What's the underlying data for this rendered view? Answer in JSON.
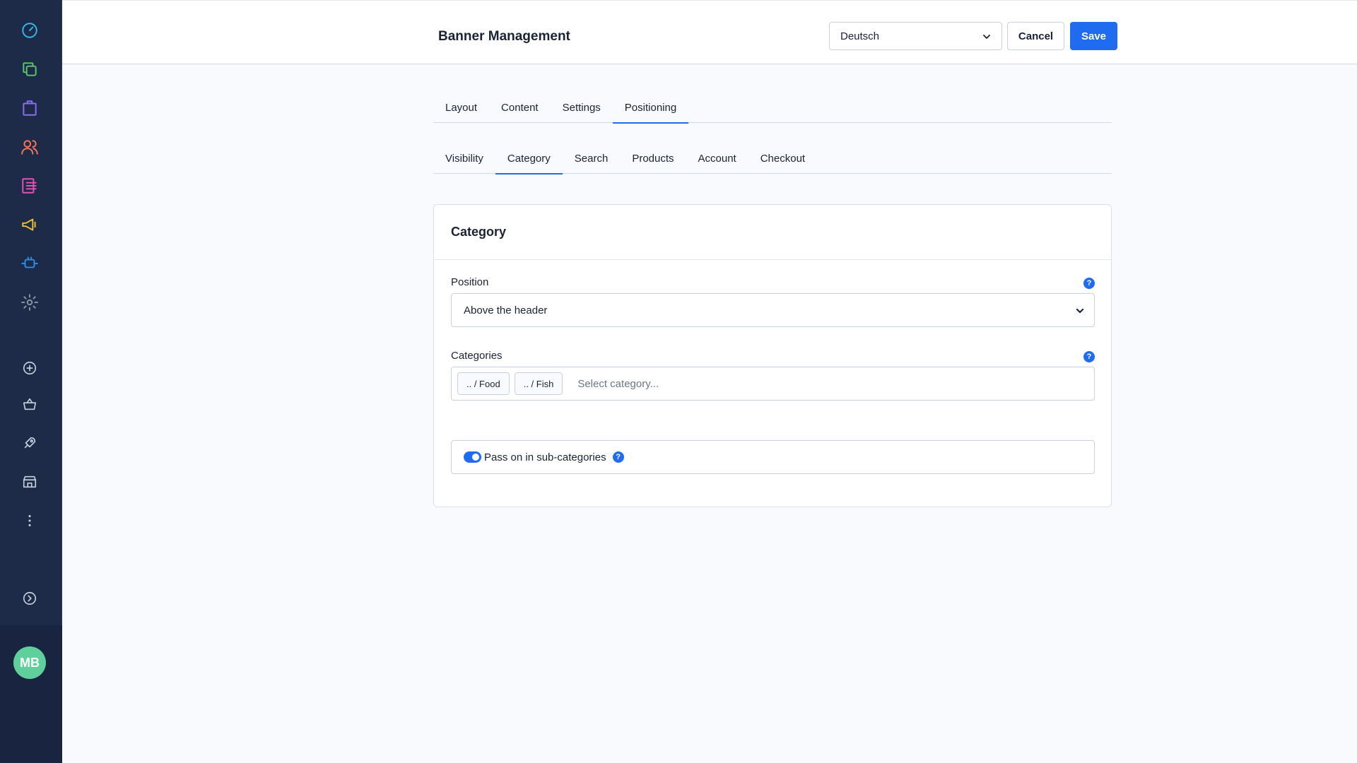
{
  "sidebar": {
    "items": [
      {
        "icon": "dashboard-gauge-icon",
        "color": "#38b6e8"
      },
      {
        "icon": "catalogues-copy-icon",
        "color": "#5bc96a"
      },
      {
        "icon": "orders-bag-icon",
        "color": "#8a6ef2"
      },
      {
        "icon": "customers-users-icon",
        "color": "#f27a5b"
      },
      {
        "icon": "content-list-icon",
        "color": "#e64fb5"
      },
      {
        "icon": "marketing-megaphone-icon",
        "color": "#f2c230"
      },
      {
        "icon": "extensions-plug-icon",
        "color": "#2c8bea"
      },
      {
        "icon": "settings-gear-icon",
        "color": "#8896a8"
      },
      {
        "icon": "add-circle-icon",
        "color": "#c6cfdc"
      },
      {
        "icon": "basket-icon",
        "color": "#c6cfdc"
      },
      {
        "icon": "rocket-icon",
        "color": "#c6cfdc"
      },
      {
        "icon": "storefront-icon",
        "color": "#c6cfdc"
      },
      {
        "icon": "more-vertical-icon",
        "color": "#c6cfdc"
      }
    ],
    "collapse_icon": "chevron-right-circle-icon",
    "avatar_initials": "MB",
    "avatar_color": "#5fcf9b"
  },
  "header": {
    "title": "Banner Management",
    "language": "Deutsch",
    "cancel_label": "Cancel",
    "save_label": "Save",
    "accent": "#1f6cf0"
  },
  "main_tabs": [
    {
      "label": "Layout",
      "active": false
    },
    {
      "label": "Content",
      "active": false
    },
    {
      "label": "Settings",
      "active": false
    },
    {
      "label": "Positioning",
      "active": true
    }
  ],
  "sub_tabs": [
    {
      "label": "Visibility",
      "active": false
    },
    {
      "label": "Category",
      "active": true
    },
    {
      "label": "Search",
      "active": false
    },
    {
      "label": "Products",
      "active": false
    },
    {
      "label": "Account",
      "active": false
    },
    {
      "label": "Checkout",
      "active": false
    }
  ],
  "card": {
    "title": "Category",
    "position": {
      "label": "Position",
      "value": "Above the header"
    },
    "categories": {
      "label": "Categories",
      "chips": [
        ".. / Food",
        ".. / Fish"
      ],
      "placeholder": "Select category..."
    },
    "pass_on": {
      "label": "Pass on in sub-categories",
      "enabled": true
    },
    "help_glyph": "?"
  }
}
